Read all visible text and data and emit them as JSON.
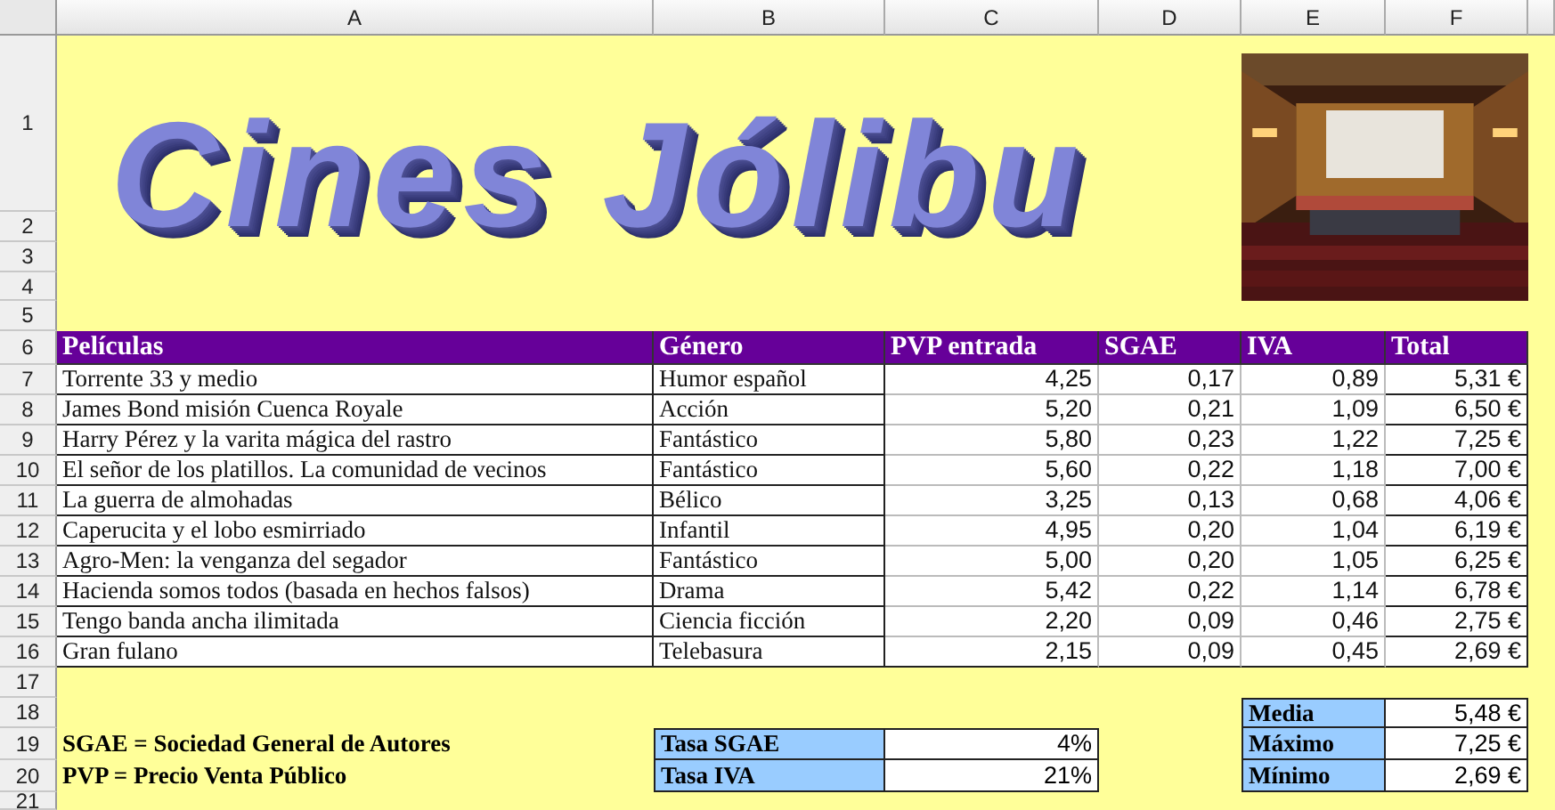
{
  "column_headers": [
    "A",
    "B",
    "C",
    "D",
    "E",
    "F"
  ],
  "row_headers": [
    "1",
    "2",
    "3",
    "4",
    "5",
    "6",
    "7",
    "8",
    "9",
    "10",
    "11",
    "12",
    "13",
    "14",
    "15",
    "16",
    "17",
    "18",
    "19",
    "20",
    "21"
  ],
  "title": "Cines Jólibu",
  "photo": {
    "kind": "picture"
  },
  "table": {
    "columns": [
      "Películas",
      "Género",
      "PVP entrada",
      "SGAE",
      "IVA",
      "Total"
    ],
    "rows": [
      [
        "Torrente 33 y medio",
        "Humor español",
        "4,25",
        "0,17",
        "0,89",
        "5,31 €"
      ],
      [
        "James Bond misión Cuenca Royale",
        "Acción",
        "5,20",
        "0,21",
        "1,09",
        "6,50 €"
      ],
      [
        "Harry Pérez y la varita mágica del rastro",
        "Fantástico",
        "5,80",
        "0,23",
        "1,22",
        "7,25 €"
      ],
      [
        "El señor de los platillos. La comunidad de vecinos",
        "Fantástico",
        "5,60",
        "0,22",
        "1,18",
        "7,00 €"
      ],
      [
        "La guerra de almohadas",
        "Bélico",
        "3,25",
        "0,13",
        "0,68",
        "4,06 €"
      ],
      [
        "Caperucita y el lobo esmirriado",
        "Infantil",
        "4,95",
        "0,20",
        "1,04",
        "6,19 €"
      ],
      [
        "Agro-Men: la venganza del segador",
        "Fantástico",
        "5,00",
        "0,20",
        "1,05",
        "6,25 €"
      ],
      [
        "Hacienda somos todos (basada en hechos falsos)",
        "Drama",
        "5,42",
        "0,22",
        "1,14",
        "6,78 €"
      ],
      [
        "Tengo banda ancha ilimitada",
        "Ciencia ficción",
        "2,20",
        "0,09",
        "0,46",
        "2,75 €"
      ],
      [
        "Gran fulano",
        "Telebasura",
        "2,15",
        "0,09",
        "0,45",
        "2,69 €"
      ]
    ]
  },
  "notes": [
    "SGAE = Sociedad General de Autores",
    "PVP = Precio Venta Público"
  ],
  "rates": [
    {
      "label": "Tasa SGAE",
      "value": "4%"
    },
    {
      "label": "Tasa IVA",
      "value": "21%"
    }
  ],
  "stats": [
    {
      "label": "Media",
      "value": "5,48 €"
    },
    {
      "label": "Máximo",
      "value": "7,25 €"
    },
    {
      "label": "Mínimo",
      "value": "2,69 €"
    }
  ]
}
